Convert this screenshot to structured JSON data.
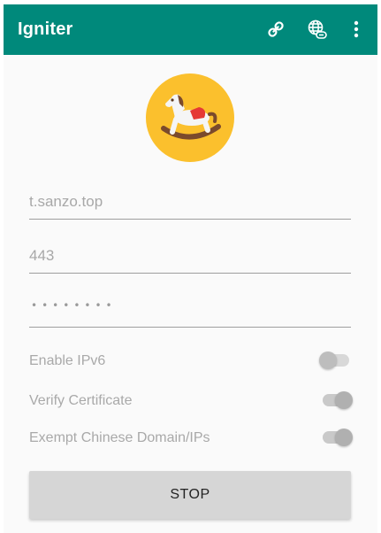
{
  "app_bar": {
    "title": "Igniter",
    "icons": [
      "link-icon",
      "globe-link-icon",
      "overflow-menu-icon"
    ],
    "color": "#00897b"
  },
  "form": {
    "server_placeholder": "t.sanzo.top",
    "port_placeholder": "443",
    "password_mask": "••••••••"
  },
  "switches": [
    {
      "label": "Enable IPv6",
      "state": "off"
    },
    {
      "label": "Verify Certificate",
      "state": "on"
    },
    {
      "label": "Exempt Chinese Domain/IPs",
      "state": "on"
    }
  ],
  "actions": {
    "stop_label": "STOP"
  },
  "logo": {
    "icon": "rocking-horse-icon",
    "background": "#fbc02d"
  }
}
